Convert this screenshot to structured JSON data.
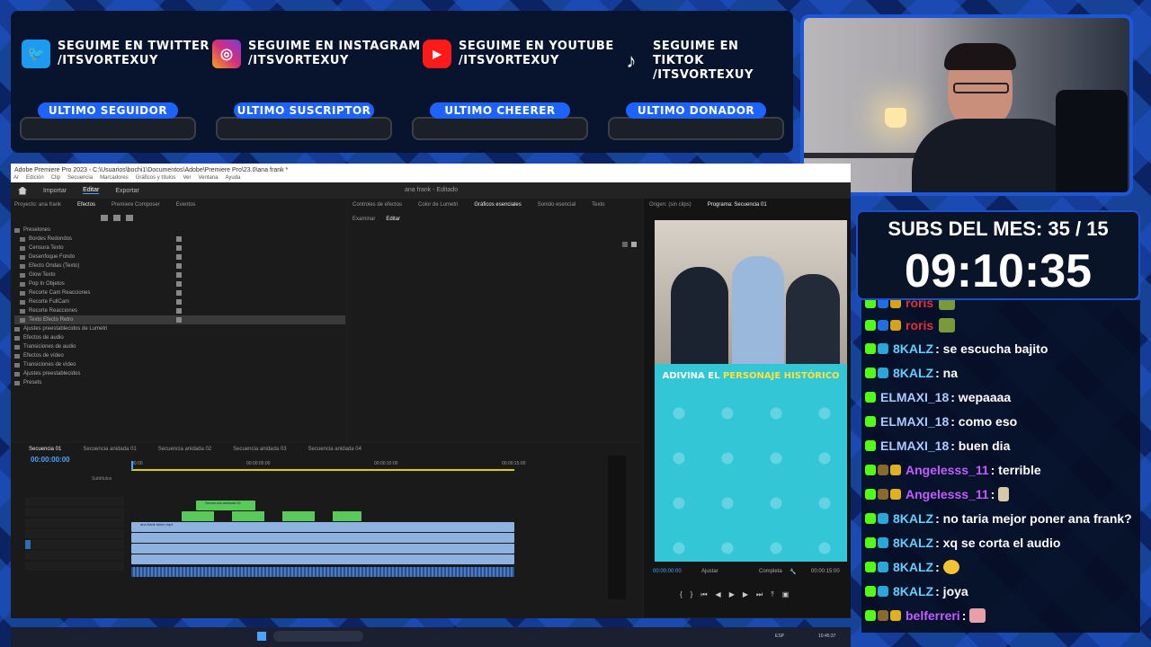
{
  "socials": [
    {
      "line1": "SEGUIME EN TWITTER",
      "line2": "/ITSVORTEXUY",
      "icon": "twitter-icon",
      "color": "#1d9bf0",
      "glyph": "🐦"
    },
    {
      "line1": "SEGUIME EN INSTAGRAM",
      "line2": "/ITSVORTEXUY",
      "icon": "instagram-icon",
      "color": "#d62f7a",
      "glyph": "◎"
    },
    {
      "line1": "SEGUIME EN YOUTUBE",
      "line2": "/ITSVORTEXUY",
      "icon": "youtube-icon",
      "color": "#ff1a1a",
      "glyph": "▶"
    },
    {
      "line1": "SEGUIME EN TIKTOK",
      "line2": "/ITSVORTEXUY",
      "icon": "tiktok-icon",
      "color": "#08142d",
      "glyph": "♪"
    }
  ],
  "stat_boxes": [
    "ULTIMO SEGUIDOR",
    "ULTIMO SUSCRIPTOR",
    "ULTIMO CHEERER",
    "ULTIMO DONADOR"
  ],
  "premiere": {
    "window_title": "Adobe Premiere Pro 2023 - C:\\Usuarios\\bochi1\\Documentos\\Adobe\\Premiere Pro\\23.0\\ana frank *",
    "menu": [
      "Ar",
      "Edición",
      "Clip",
      "Secuencia",
      "Marcadores",
      "Gráficos y títulos",
      "Ver",
      "Ventana",
      "Ayuda"
    ],
    "workspace_tabs": [
      "Importar",
      "Editar",
      "Exportar"
    ],
    "project_title": "ana frank",
    "project_status": "Editado",
    "effects_tabs": [
      "Proyecto: ana frank",
      "Efectos",
      "Premiere Composer",
      "Eventos"
    ],
    "presets_root": "Preselones",
    "presets": [
      "Bordes Redondos",
      "Censura Texto",
      "Desenfoque Fondo",
      "Efecto Ondas (Texto)",
      "Glow Texto",
      "Pop In Objetos",
      "Recorte Cam Reacciones",
      "Recorte FullCam",
      "Recorte Reacciones",
      "Texto Efecto Retro"
    ],
    "folders": [
      "Ajustes preestablecidos de Lumetri",
      "Efectos de audio",
      "Transiciones de audio",
      "Efectos de vídeo",
      "Transiciones de vídeo",
      "Ajustes preestablecidos",
      "Presets"
    ],
    "middle_tabs": [
      "Controles de efectos",
      "Color de Lumetri",
      "Gráficos esenciales",
      "Sonido esencial",
      "Texto"
    ],
    "sub_tabs": [
      "Examinar",
      "Editar"
    ],
    "program_tabs": [
      "Origen: (sin clips)",
      "Programa: Secuencia 01"
    ],
    "caption_a": "ADIVINA EL ",
    "caption_b": "PERSONAJE HISTÓRICO",
    "program_timecode": "00:00:00:00",
    "fit_label": "Ajustar",
    "quality_label": "Completa",
    "program_duration": "00:00:15:00",
    "sequence_tabs": [
      "Secuencia 01",
      "Secuencia anidada 01",
      "Secuencia anidada 02",
      "Secuencia anidada 03",
      "Secuencia anidada 04"
    ],
    "timeline_timecode": "00:00:00:00",
    "ruler": [
      "00:00",
      "00:00:05:00",
      "00:00:10:00",
      "00:00:15:00"
    ],
    "subtitles_label": "Subtítulos",
    "nested_clip": "Secuencia anidada 04",
    "clip_label": "ana frank belen.mp4"
  },
  "subs": {
    "title": "SUBS DEL MES: 35 / 15",
    "timer": "09:10:35"
  },
  "chat": [
    {
      "user": "roris",
      "msg": "",
      "color": "#e0303a",
      "emote": "#7a9a3a"
    },
    {
      "user": "roris",
      "msg": "",
      "color": "#e0303a",
      "emote": "#7a9a3a"
    },
    {
      "user": "8KALZ",
      "msg": ": se escucha bajito",
      "color": "#5fd0ff",
      "emote": ""
    },
    {
      "user": "8KALZ",
      "msg": ": na",
      "color": "#5fd0ff",
      "emote": ""
    },
    {
      "user": "ELMAXI_18",
      "msg": ": wepaaaa",
      "color": "#a9c9ff",
      "emote": ""
    },
    {
      "user": "ELMAXI_18",
      "msg": ": como eso",
      "color": "#a9c9ff",
      "emote": ""
    },
    {
      "user": "ELMAXI_18",
      "msg": ": buen dia",
      "color": "#a9c9ff",
      "emote": ""
    },
    {
      "user": "Angelesss_11",
      "msg": ": terrible",
      "color": "#c35cff",
      "emote": ""
    },
    {
      "user": "Angelesss_11",
      "msg": ":",
      "color": "#c35cff",
      "emote": "#d9c8a8"
    },
    {
      "user": "8KALZ",
      "msg": ": no taria mejor poner ana frank?",
      "color": "#5fd0ff",
      "emote": ""
    },
    {
      "user": "8KALZ",
      "msg": ": xq se corta el audio",
      "color": "#5fd0ff",
      "emote": ""
    },
    {
      "user": "8KALZ",
      "msg": ":",
      "color": "#5fd0ff",
      "emote": "#f4c430"
    },
    {
      "user": "8KALZ",
      "msg": ": joya",
      "color": "#5fd0ff",
      "emote": ""
    },
    {
      "user": "belferreri",
      "msg": ":",
      "color": "#c35cff",
      "emote": "#e8a0a8"
    }
  ],
  "taskbar": {
    "lang": "ESP",
    "time": "10:45:37"
  }
}
